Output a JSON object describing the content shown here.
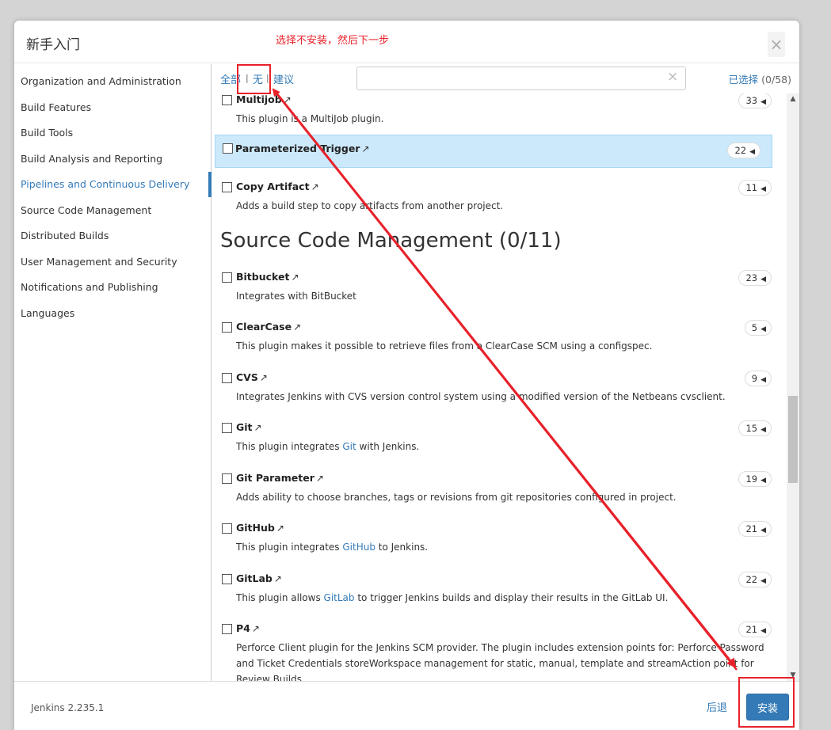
{
  "dialog": {
    "title": "新手入门",
    "close_glyph": "×",
    "annotation": "选择不安装，然后下一步"
  },
  "sidebar": {
    "items": [
      {
        "label": "Organization and Administration"
      },
      {
        "label": "Build Features"
      },
      {
        "label": "Build Tools"
      },
      {
        "label": "Build Analysis and Reporting"
      },
      {
        "label": "Pipelines and Continuous Delivery",
        "active": true
      },
      {
        "label": "Source Code Management"
      },
      {
        "label": "Distributed Builds"
      },
      {
        "label": "User Management and Security"
      },
      {
        "label": "Notifications and Publishing"
      },
      {
        "label": "Languages"
      }
    ]
  },
  "toolbar": {
    "all_label": "全部",
    "none_label": "无",
    "suggested_label": "建议",
    "separator": "|",
    "search_value": "",
    "clear_glyph": "×",
    "selected_link": "已选择",
    "selected_count": "(0/58)"
  },
  "plugins": [
    {
      "name": "Multijob",
      "desc": "This plugin is a MultiJob plugin.",
      "deps": "33"
    },
    {
      "name": "Parameterized Trigger",
      "desc": "",
      "deps": "22",
      "highlighted": true
    },
    {
      "name": "Copy Artifact",
      "desc": "Adds a build step to copy artifacts from another project.",
      "deps": "11"
    },
    {
      "name": "Bitbucket",
      "desc": "Integrates with BitBucket",
      "deps": "23"
    },
    {
      "name": "ClearCase",
      "desc": "This plugin makes it possible to retrieve files from a ClearCase SCM using a configspec.",
      "deps": "5"
    },
    {
      "name": "CVS",
      "desc": "Integrates Jenkins with CVS version control system using a modified version of the Netbeans cvsclient.",
      "deps": "9"
    },
    {
      "name": "Git",
      "desc_pre": "This plugin integrates ",
      "desc_link": "Git",
      "desc_post": " with Jenkins.",
      "deps": "15"
    },
    {
      "name": "Git Parameter",
      "desc": "Adds ability to choose branches, tags or revisions from git repositories configured in project.",
      "deps": "19"
    },
    {
      "name": "GitHub",
      "desc_pre": "This plugin integrates ",
      "desc_link": "GitHub",
      "desc_post": " to Jenkins.",
      "deps": "21"
    },
    {
      "name": "GitLab",
      "desc_pre": "This plugin allows ",
      "desc_link": "GitLab",
      "desc_post": " to trigger Jenkins builds and display their results in the GitLab UI.",
      "deps": "22"
    },
    {
      "name": "P4",
      "desc": "Perforce Client plugin for the Jenkins SCM provider. The plugin includes extension points for: Perforce Password and Ticket Credentials storeWorkspace management for static, manual, template and streamAction point for Review Builds",
      "deps": "21"
    }
  ],
  "section": {
    "title": "Source Code Management (0/11)"
  },
  "link_arrow": "↗",
  "badge_triangle": "◀",
  "scrollbar": {
    "up": "▲",
    "down": "▼"
  },
  "footer": {
    "version": "Jenkins 2.235.1",
    "back_label": "后退",
    "install_label": "安装"
  },
  "colors": {
    "accent": "#337ab7",
    "annotation": "#e8212a",
    "highlight_row": "#cce9fb"
  }
}
